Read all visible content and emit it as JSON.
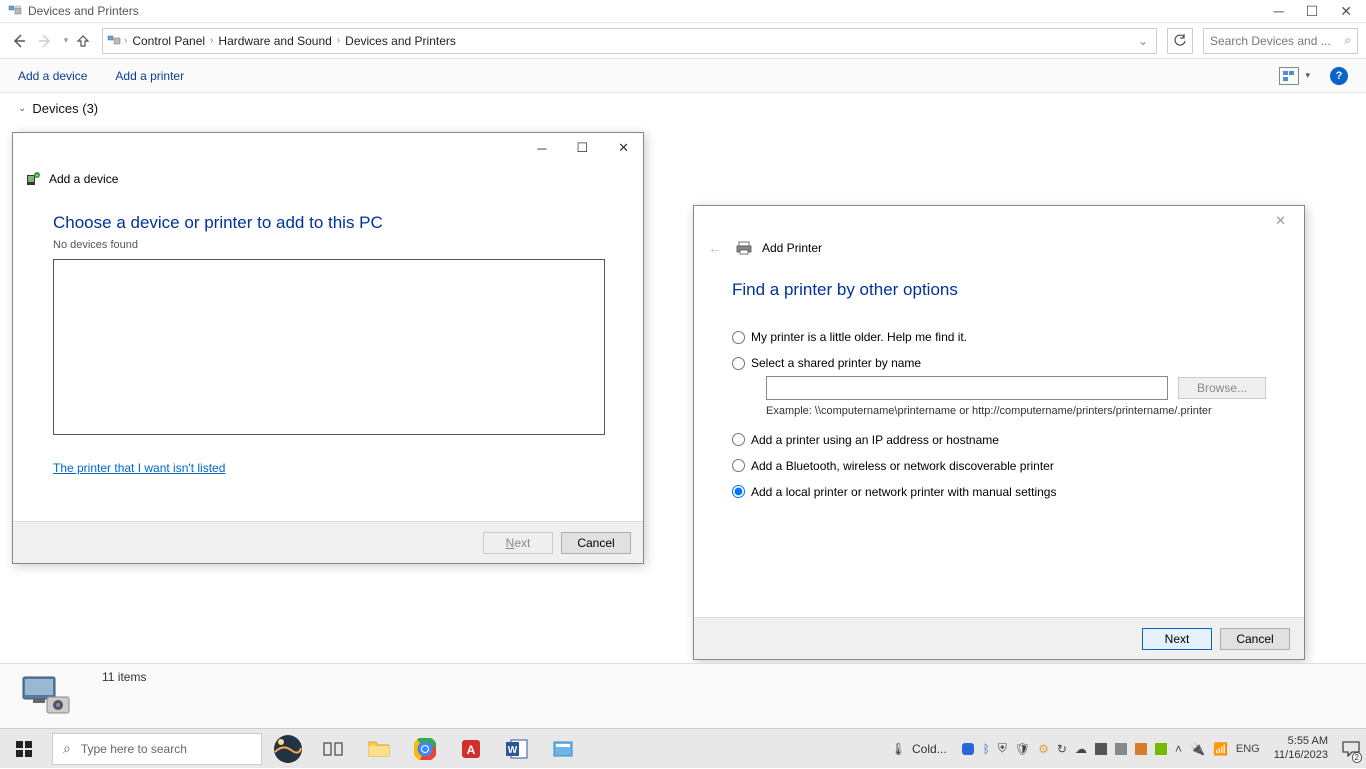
{
  "window": {
    "title": "Devices and Printers"
  },
  "breadcrumb": {
    "root_icon": "control-panel",
    "parts": [
      "Control Panel",
      "Hardware and Sound",
      "Devices and Printers"
    ]
  },
  "search": {
    "placeholder": "Search Devices and ..."
  },
  "commands": {
    "add_device": "Add a device",
    "add_printer": "Add a printer"
  },
  "group": {
    "label": "Devices (3)"
  },
  "dlg_add_device": {
    "header": "Add a device",
    "title": "Choose a device or printer to add to this PC",
    "subtitle": "No devices found",
    "link": "The printer that I want isn't listed",
    "next": "Next",
    "cancel": "Cancel"
  },
  "dlg_add_printer": {
    "header": "Add Printer",
    "title": "Find a printer by other options",
    "opt_older": "My printer is a little older. Help me find it.",
    "opt_shared": "Select a shared printer by name",
    "browse": "Browse...",
    "example": "Example: \\\\computername\\printername or http://computername/printers/printername/.printer",
    "opt_ip": "Add a printer using an IP address or hostname",
    "opt_bt": "Add a Bluetooth, wireless or network discoverable printer",
    "opt_local": "Add a local printer or network printer with manual settings",
    "next": "Next",
    "cancel": "Cancel"
  },
  "status": {
    "items": "11 items"
  },
  "taskbar": {
    "search_placeholder": "Type here to search",
    "weather": "Cold...",
    "lang": "ENG",
    "time": "5:55 AM",
    "date": "11/16/2023",
    "notif_count": "2"
  }
}
